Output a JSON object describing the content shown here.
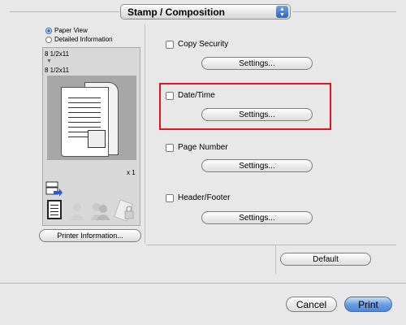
{
  "popup": {
    "label": "Stamp / Composition",
    "icon": "popup-arrows-icon"
  },
  "view_options": [
    {
      "label": "Paper View",
      "selected": true
    },
    {
      "label": "Detailed Information",
      "selected": false
    }
  ],
  "preview": {
    "original_size": "8 1/2x11",
    "output_size": "8 1/2x11",
    "copies": "x 1"
  },
  "printer_info_label": "Printer Information...",
  "stamp_items": [
    {
      "label": "Copy Security",
      "checked": false,
      "button": "Settings..."
    },
    {
      "label": "Date/Time",
      "checked": false,
      "button": "Settings..."
    },
    {
      "label": "Page Number",
      "checked": false,
      "button": "Settings..."
    },
    {
      "label": "Header/Footer",
      "checked": false,
      "button": "Settings..."
    }
  ],
  "default_label": "Default",
  "cancel_label": "Cancel",
  "print_label": "Print",
  "colors": {
    "highlight": "#e0141e",
    "primary_button": "#4d86d8"
  }
}
